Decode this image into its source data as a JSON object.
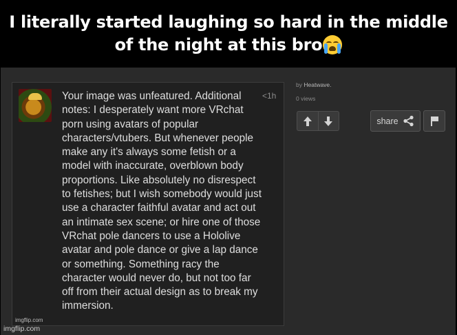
{
  "caption": {
    "text": "I literally started laughing so hard in the middle of the night at this bro",
    "emoji": "loudly-crying-face-icon"
  },
  "notification": {
    "text": "Your image was unfeatured. Additional notes: I desperately want more VRchat porn using avatars of popular characters/vtubers. But whenever people make any it's always some fetish or a model with inaccurate, overblown body proportions. Like absolutely no disrespect to fetishes; but I wish somebody would just use a character faithful avatar and act out an intimate sex scene; or hire one of those VRchat pole dancers to use a Hololive avatar and pole dance or give a lap dance or something. Something racy the character would never do, but not too far off from their actual design as to break my immersion.",
    "time": "<1h",
    "avatar_icon": "bowser-avatar"
  },
  "post": {
    "by_prefix": "by",
    "username": "Heatwave.",
    "views": "0 views"
  },
  "actions": {
    "upvote_icon": "arrow-up-icon",
    "downvote_icon": "arrow-down-icon",
    "share_label": "share",
    "share_icon": "share-icon",
    "flag_icon": "flag-icon"
  },
  "watermarks": {
    "inner": "imgflip.com",
    "outer": "imgflip.com"
  },
  "colors": {
    "background": "#000000",
    "screenshot_bg": "#2a2a2a",
    "panel_bg": "#202020",
    "text": "#dedede"
  }
}
